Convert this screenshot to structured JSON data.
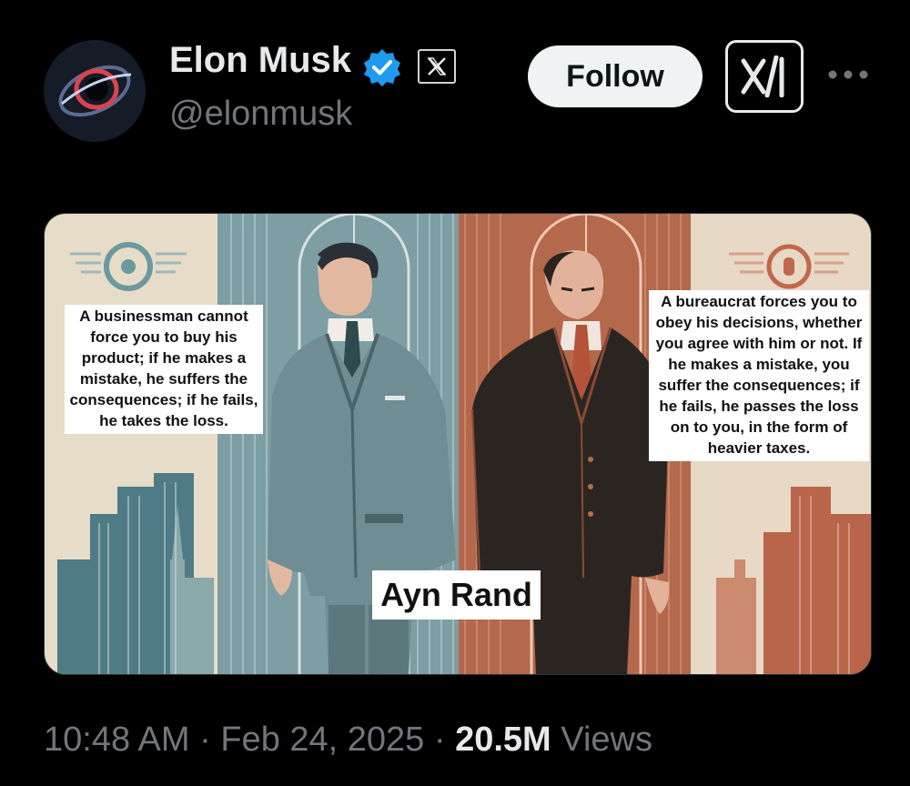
{
  "author": {
    "display_name": "Elon Musk",
    "handle": "@elonmusk",
    "verified_icon": "verified-badge-icon",
    "affiliation_icon": "x-logo-icon"
  },
  "actions": {
    "follow_label": "Follow",
    "grok_icon": "grok-icon",
    "more_icon": "more-options-icon"
  },
  "media": {
    "left_caption": "A businessman cannot force you to buy his product; if he makes a mistake, he suffers the consequences; if he fails, he takes the loss.",
    "right_caption": "A bureaucrat forces you to obey his decisions, whether you agree with him or not. If he makes a mistake, you suffer the consequences; if he fails, he passes the loss on to you, in the form of heavier taxes.",
    "title": "Ayn Rand",
    "colors": {
      "left_panel": "#7a9aa0",
      "right_panel": "#b2664a",
      "background": "#e6d9c4"
    }
  },
  "meta": {
    "time": "10:48 AM",
    "separator": "·",
    "date": "Feb 24, 2025",
    "views_count": "20.5M",
    "views_label": "Views"
  }
}
